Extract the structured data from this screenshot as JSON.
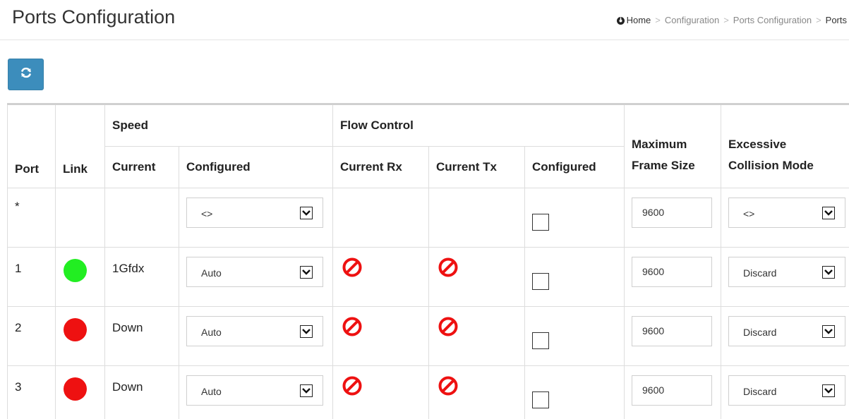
{
  "header": {
    "title": "Ports Configuration",
    "breadcrumb": [
      "Home",
      "Configuration",
      "Ports Configuration",
      "Ports"
    ]
  },
  "toolbar": {
    "refresh_icon": "refresh-icon"
  },
  "colors": {
    "accent": "#3c8dbc",
    "link_up": "#22ee22",
    "link_down": "#ee1111",
    "disabled_icon": "#ee1111"
  },
  "table": {
    "headers": {
      "port": "Port",
      "link": "Link",
      "speed": "Speed",
      "speed_current": "Current",
      "speed_configured": "Configured",
      "flow_control": "Flow Control",
      "fc_current_rx": "Current Rx",
      "fc_current_tx": "Current Tx",
      "fc_configured": "Configured",
      "max_frame_1": "Maximum",
      "max_frame_2": "Frame Size",
      "ecm_1": "Excessive",
      "ecm_2": "Collision Mode"
    },
    "rows": [
      {
        "port": "*",
        "link": "",
        "speed_current": "",
        "speed_configured": "<>",
        "fc_rx": "",
        "fc_tx": "",
        "fc_configured": false,
        "max_frame": "9600",
        "ecm": "<>"
      },
      {
        "port": "1",
        "link": "up",
        "speed_current": "1Gfdx",
        "speed_configured": "Auto",
        "fc_rx": "disabled-icon",
        "fc_tx": "disabled-icon",
        "fc_configured": false,
        "max_frame": "9600",
        "ecm": "Discard"
      },
      {
        "port": "2",
        "link": "down",
        "speed_current": "Down",
        "speed_configured": "Auto",
        "fc_rx": "disabled-icon",
        "fc_tx": "disabled-icon",
        "fc_configured": false,
        "max_frame": "9600",
        "ecm": "Discard"
      },
      {
        "port": "3",
        "link": "down",
        "speed_current": "Down",
        "speed_configured": "Auto",
        "fc_rx": "disabled-icon",
        "fc_tx": "disabled-icon",
        "fc_configured": false,
        "max_frame": "9600",
        "ecm": "Discard"
      }
    ]
  }
}
